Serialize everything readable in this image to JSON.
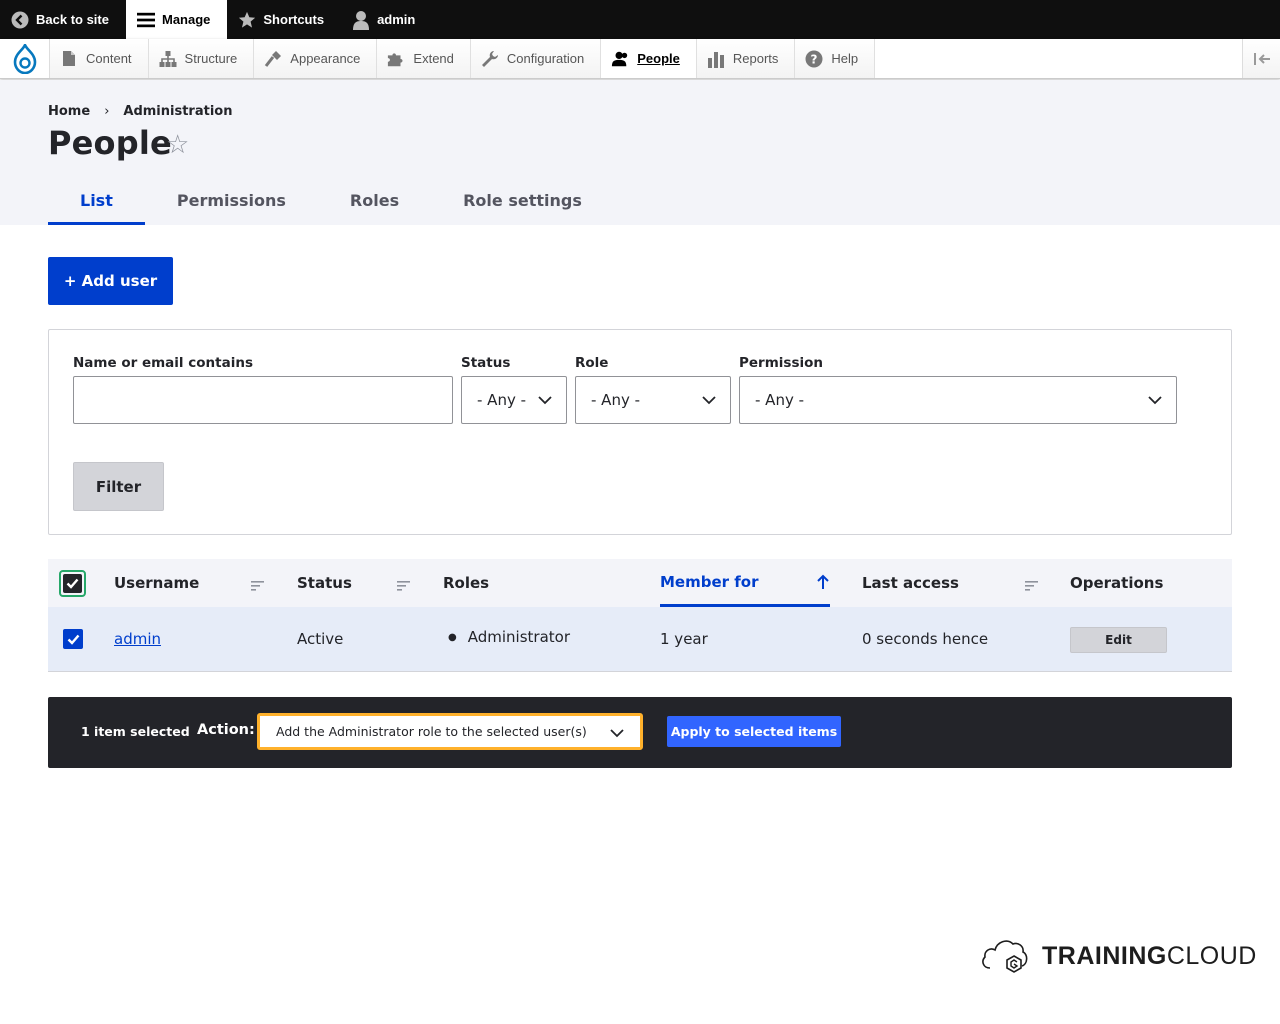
{
  "toolbar": {
    "back_label": "Back to site",
    "manage_label": "Manage",
    "shortcuts_label": "Shortcuts",
    "user_label": "admin"
  },
  "tray": {
    "items": [
      {
        "label": "Content",
        "icon": "file-icon"
      },
      {
        "label": "Structure",
        "icon": "sitemap-icon"
      },
      {
        "label": "Appearance",
        "icon": "paintbrush-icon"
      },
      {
        "label": "Extend",
        "icon": "puzzle-icon"
      },
      {
        "label": "Configuration",
        "icon": "wrench-icon"
      },
      {
        "label": "People",
        "icon": "people-icon"
      },
      {
        "label": "Reports",
        "icon": "bar-chart-icon"
      },
      {
        "label": "Help",
        "icon": "help-icon"
      }
    ]
  },
  "breadcrumb": {
    "home": "Home",
    "separator": "›",
    "admin": "Administration"
  },
  "page": {
    "title": "People",
    "star": "☆"
  },
  "tabs": [
    "List",
    "Permissions",
    "Roles",
    "Role settings"
  ],
  "add_user_label": "+ Add user",
  "filter": {
    "name_label": "Name or email contains",
    "name_value": "",
    "status_label": "Status",
    "status_value": "- Any -",
    "role_label": "Role",
    "role_value": "- Any -",
    "permission_label": "Permission",
    "permission_value": "- Any -",
    "button_label": "Filter"
  },
  "table": {
    "headers": [
      "Username",
      "Status",
      "Roles",
      "Member for",
      "Last access",
      "Operations"
    ],
    "sorted_column": "Member for",
    "rows": [
      {
        "username": "admin",
        "status": "Active",
        "roles": [
          "Administrator"
        ],
        "member_for": "1 year",
        "last_access": "0 seconds hence",
        "operation": "Edit"
      }
    ]
  },
  "bulk": {
    "count": "1 item selected",
    "action_label": "Action:",
    "action_value": "Add the Administrator role to the selected user(s)",
    "apply_label": "Apply to selected items"
  },
  "watermark": {
    "bold": "TRAINING",
    "normal": "CLOUD"
  },
  "colors": {
    "accent": "#003ecc",
    "toolbar": "#0f0f0f",
    "bulk_bar": "#232429",
    "focus_outline": "#ffb12b"
  }
}
